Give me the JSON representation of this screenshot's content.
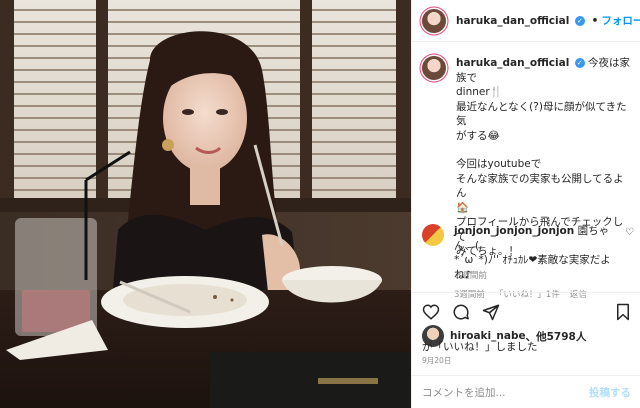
{
  "header": {
    "username": "haruka_dan_official",
    "separator": "•",
    "follow_label": "フォローする"
  },
  "caption": {
    "username": "haruka_dan_official",
    "lines": [
      "今夜は家族で",
      "dinner🍴",
      "最近なんとなく(?)母に顔が似てきた気",
      "がする😂",
      "",
      "今回はyoutubeで",
      "そんな家族での実家も公開してるよん",
      "🏠",
      "プロフィールから飛んでチェックして",
      "みてちょ。！"
    ],
    "age": "3週間前"
  },
  "comment": {
    "username": "jonjon_jonjon_jonjon",
    "text_lines": [
      "園ちゃん、(",
      "*´ω`*)ﾉ'' ｵﾁｭｶﾚ❤素敵な実家だよ",
      "ね♪"
    ],
    "age": "3週間前",
    "likes": "「いいね！」1件",
    "reply": "返信"
  },
  "likes": {
    "liker": "hiroaki_nabe",
    "others": "、他5798人",
    "suffix": "が「いいね！」しました"
  },
  "date": "9月20日",
  "comment_input": {
    "placeholder": "コメントを追加...",
    "post_label": "投稿する"
  },
  "icons": {
    "like": "heart-icon",
    "comment": "comment-icon",
    "share": "share-icon",
    "save": "bookmark-icon",
    "verified": "verified-badge-icon"
  },
  "colors": {
    "link_blue": "#0095f6",
    "verified_blue": "#3897f0",
    "muted_gray": "#8e8e8e",
    "post_disabled": "#b2dffc"
  }
}
